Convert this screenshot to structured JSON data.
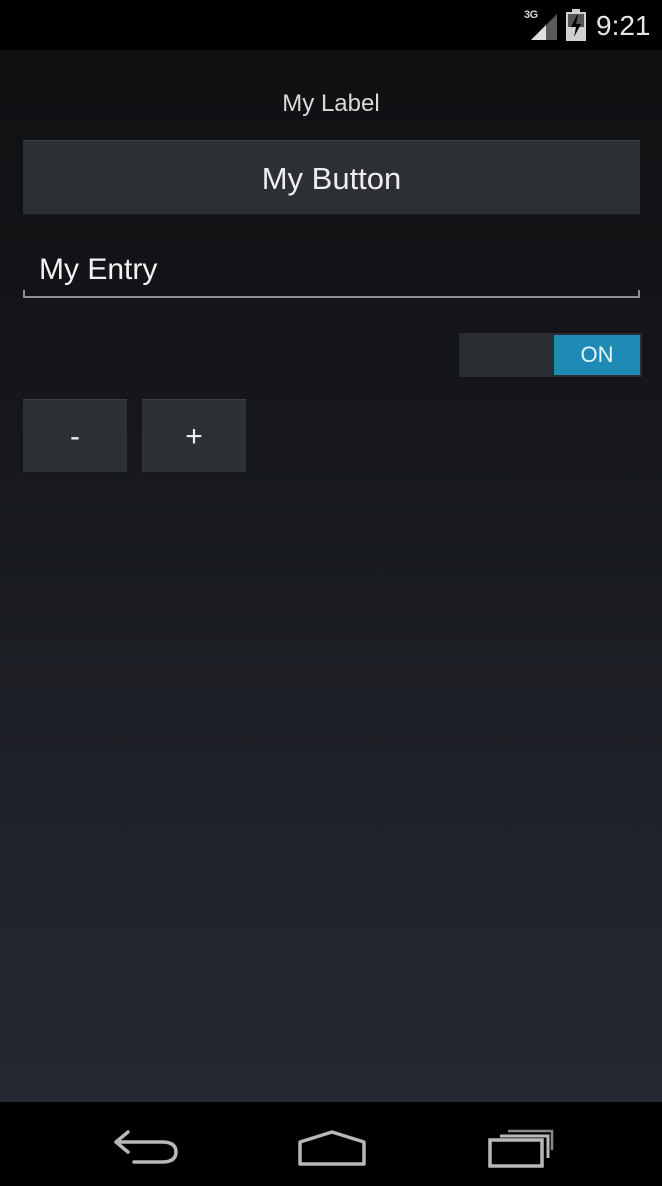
{
  "status_bar": {
    "network_type": "3G",
    "time": "9:21",
    "signal_icon": "signal-bars-icon",
    "battery_icon": "battery-charging-icon"
  },
  "app": {
    "label": "My Label",
    "button_label": "My Button",
    "entry_value": "My Entry",
    "switch": {
      "state_text": "ON",
      "accent_color": "#1f8ab6"
    },
    "stepper": {
      "decrement_label": "-",
      "increment_label": "+"
    }
  },
  "nav_bar": {
    "back_icon": "back-arrow-icon",
    "home_icon": "home-icon",
    "recents_icon": "recent-apps-icon"
  }
}
